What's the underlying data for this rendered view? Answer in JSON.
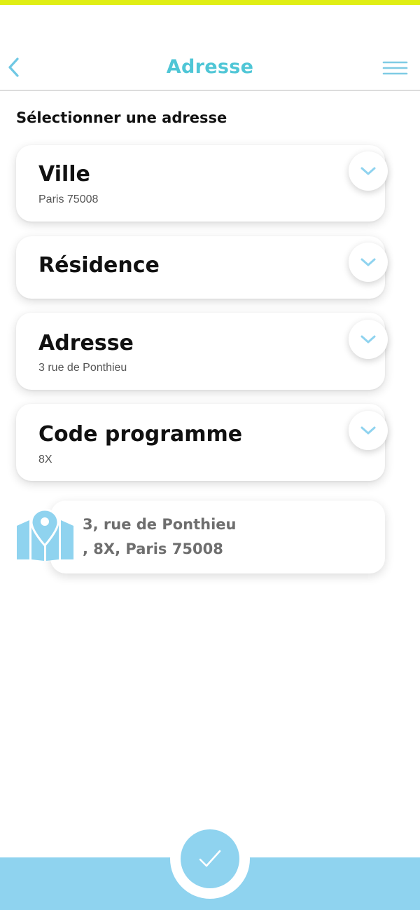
{
  "header": {
    "title": "Adresse",
    "back_icon": "chevron-left-icon",
    "menu_icon": "hamburger-menu-icon"
  },
  "section_label": "Sélectionner une adresse",
  "fields": [
    {
      "title": "Ville",
      "value": "Paris 75008"
    },
    {
      "title": "Résidence",
      "value": ""
    },
    {
      "title": "Adresse",
      "value": "3 rue de Ponthieu"
    },
    {
      "title": "Code programme",
      "value": "8X"
    }
  ],
  "summary": {
    "line1": "3, rue de Ponthieu",
    "line2": ", 8X, Paris 75008",
    "icon": "map-pin-icon"
  },
  "footer": {
    "confirm_icon": "checkmark-icon"
  },
  "colors": {
    "accent": "#4fc6d6",
    "light_blue": "#8fd3ef",
    "top_bar": "#e0ee14"
  }
}
